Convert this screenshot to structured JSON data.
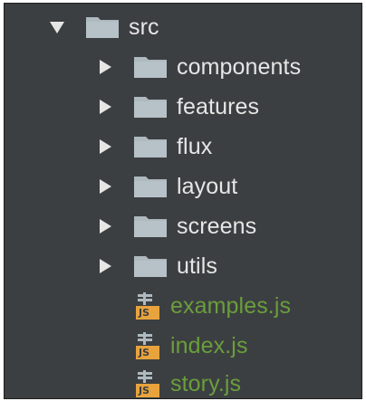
{
  "project_tree": {
    "root": {
      "label": "src",
      "expanded": true,
      "icon": "folder-icon"
    },
    "folders": [
      {
        "label": "components",
        "expanded": false,
        "icon": "folder-icon"
      },
      {
        "label": "features",
        "expanded": false,
        "icon": "folder-icon"
      },
      {
        "label": "flux",
        "expanded": false,
        "icon": "folder-icon"
      },
      {
        "label": "layout",
        "expanded": false,
        "icon": "folder-icon"
      },
      {
        "label": "screens",
        "expanded": false,
        "icon": "folder-icon"
      },
      {
        "label": "utils",
        "expanded": false,
        "icon": "folder-icon"
      }
    ],
    "files": [
      {
        "label": "examples.js",
        "icon": "js-file-icon",
        "badge": "JS"
      },
      {
        "label": "index.js",
        "icon": "js-file-icon",
        "badge": "JS"
      },
      {
        "label": "story.js",
        "icon": "js-file-icon",
        "badge": "JS"
      }
    ]
  },
  "colors": {
    "panel_background": "#3c3f41",
    "folder_label": "#e6e6e6",
    "js_file_label": "#6a9e3c",
    "folder_icon": "#aeb9c0",
    "arrow": "#e6e6e6",
    "js_badge": "#e8a33d"
  }
}
